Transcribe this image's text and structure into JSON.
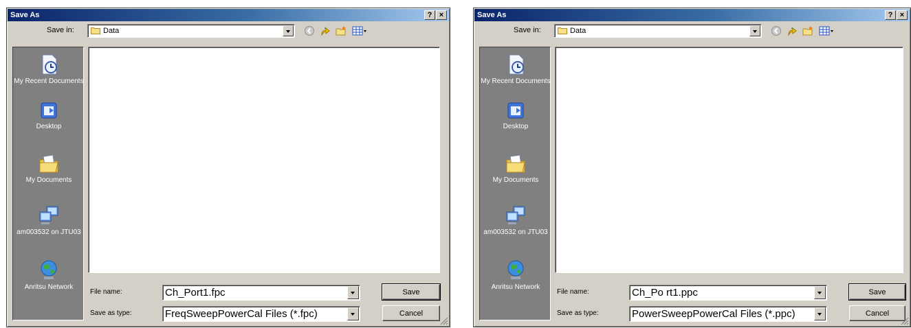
{
  "dialogs": [
    {
      "title": "Save As",
      "help_btn": "?",
      "close_btn": "×",
      "save_in_label": "Save in:",
      "save_in_value": "Data",
      "places": [
        "My Recent Documents",
        "Desktop",
        "My Documents",
        "am003532 on JTU03",
        "Anritsu Network"
      ],
      "file_name_label": "File name:",
      "file_name_value": "Ch_Port1.fpc",
      "save_type_label": "Save as type:",
      "save_type_value": "FreqSweepPowerCal Files (*.fpc)",
      "save_button": "Save",
      "cancel_button": "Cancel"
    },
    {
      "title": "Save As",
      "help_btn": "?",
      "close_btn": "×",
      "save_in_label": "Save in:",
      "save_in_value": "Data",
      "places": [
        "My Recent Documents",
        "Desktop",
        "My Documents",
        "am003532 on JTU03",
        "Anritsu Network"
      ],
      "file_name_label": "File name:",
      "file_name_value": "Ch_Po rt1.ppc",
      "save_type_label": "Save as type:",
      "save_type_value": "PowerSweepPowerCal Files (*.ppc)",
      "save_button": "Save",
      "cancel_button": "Cancel"
    }
  ],
  "icons": [
    "back-icon",
    "up-folder-icon",
    "new-folder-icon",
    "view-menu-icon"
  ],
  "colors": {
    "title_start": "#0a246a",
    "title_end": "#a6caf0",
    "dialog_face": "#d4d0c8",
    "places_bar": "#808080"
  }
}
